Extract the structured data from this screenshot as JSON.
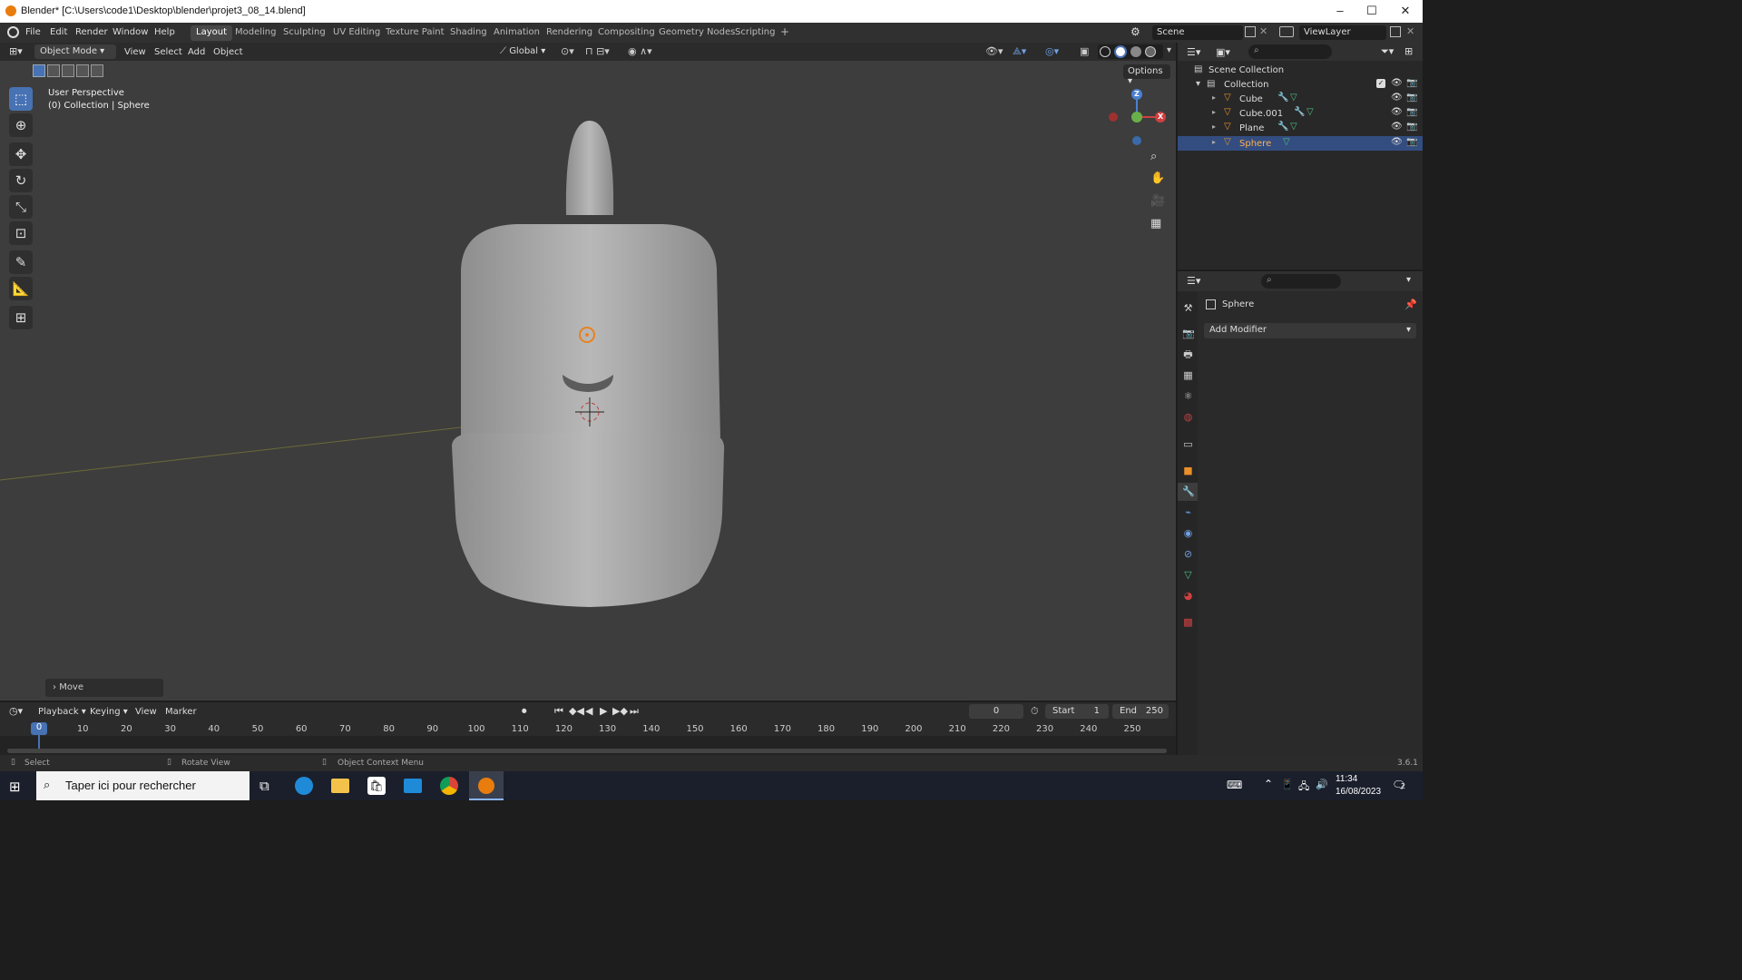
{
  "window": {
    "title": "Blender* [C:\\Users\\code1\\Desktop\\blender\\projet3_08_14.blend]"
  },
  "menu": [
    "File",
    "Edit",
    "Render",
    "Window",
    "Help"
  ],
  "workspaces": [
    "Layout",
    "Modeling",
    "Sculpting",
    "UV Editing",
    "Texture Paint",
    "Shading",
    "Animation",
    "Rendering",
    "Compositing",
    "Geometry Nodes",
    "Scripting",
    "+"
  ],
  "active_workspace": "Layout",
  "scene": {
    "name": "Scene",
    "view_layer": "ViewLayer"
  },
  "viewport": {
    "mode": "Object Mode",
    "menus": [
      "View",
      "Select",
      "Add",
      "Object"
    ],
    "orientation": "Global",
    "options_label": "Options",
    "perspective_label": "User Perspective",
    "collection_label": "(0) Collection | Sphere",
    "operator_panel": "Move",
    "gizmo": {
      "z": "Z",
      "x": "X"
    }
  },
  "outliner": {
    "root": "Scene Collection",
    "collection": "Collection",
    "items": [
      "Cube",
      "Cube.001",
      "Plane",
      "Sphere"
    ],
    "selected": "Sphere"
  },
  "properties": {
    "object": "Sphere",
    "add_modifier": "Add Modifier"
  },
  "timeline": {
    "menus": [
      "Playback",
      "Keying",
      "View",
      "Marker"
    ],
    "current_frame": "0",
    "start_label": "Start",
    "start": "1",
    "end_label": "End",
    "end": "250",
    "playhead": "0",
    "ticks": [
      "10",
      "20",
      "30",
      "40",
      "50",
      "60",
      "70",
      "80",
      "90",
      "100",
      "110",
      "120",
      "130",
      "140",
      "150",
      "160",
      "170",
      "180",
      "190",
      "200",
      "210",
      "220",
      "230",
      "240",
      "250"
    ]
  },
  "status": {
    "select": "Select",
    "rotate": "Rotate View",
    "context": "Object Context Menu",
    "version": "3.6.1"
  },
  "taskbar": {
    "search_placeholder": "Taper ici pour rechercher",
    "time": "11:34",
    "date": "16/08/2023",
    "notifications": "2"
  }
}
